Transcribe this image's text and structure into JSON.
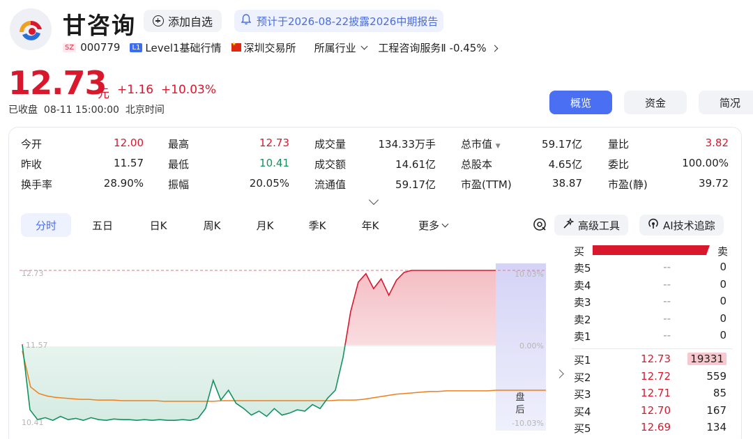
{
  "header": {
    "name": "甘咨询",
    "watch_label": "添加自选",
    "notice": "预计于2026-08-22披露2026中期报告",
    "market_tag": "SZ",
    "code": "000779",
    "level_tag": "L1",
    "level_label": "Level1基础行情",
    "exchange": "深圳交易所",
    "industry_label": "所属行业",
    "industry_value": "工程咨询服务Ⅱ",
    "industry_change": "-0.45%"
  },
  "quote": {
    "price": "12.73",
    "unit": "元",
    "change": "+1.16",
    "change_pct": "+10.03%",
    "status": "已收盘",
    "time": "08-11 15:00:00",
    "tz": "北京时间"
  },
  "tabs": [
    "概览",
    "资金",
    "简况"
  ],
  "stats": [
    [
      {
        "label": "今开",
        "value": "12.00",
        "color": "red"
      },
      {
        "label": "最高",
        "value": "12.73",
        "color": "red"
      },
      {
        "label": "成交量",
        "value": "134.33万手",
        "color": ""
      },
      {
        "label": "总市值",
        "value": "59.17亿",
        "color": ""
      },
      {
        "label": "量比",
        "value": "3.82",
        "color": "red"
      }
    ],
    [
      {
        "label": "昨收",
        "value": "11.57",
        "color": ""
      },
      {
        "label": "最低",
        "value": "10.41",
        "color": "green"
      },
      {
        "label": "成交额",
        "value": "14.61亿",
        "color": ""
      },
      {
        "label": "总股本",
        "value": "4.65亿",
        "color": ""
      },
      {
        "label": "委比",
        "value": "100.00%",
        "color": ""
      }
    ],
    [
      {
        "label": "换手率",
        "value": "28.90%",
        "color": ""
      },
      {
        "label": "振幅",
        "value": "20.05%",
        "color": ""
      },
      {
        "label": "流通值",
        "value": "59.17亿",
        "color": ""
      },
      {
        "label": "市盈(TTM)",
        "value": "38.87",
        "color": ""
      },
      {
        "label": "市盈(静)",
        "value": "39.72",
        "color": ""
      }
    ]
  ],
  "period_tabs": [
    "分时",
    "五日",
    "日K",
    "周K",
    "月K",
    "季K",
    "年K",
    "更多"
  ],
  "tools": {
    "advanced": "高级工具",
    "ai": "AI技术追踪"
  },
  "chart_data": {
    "type": "line",
    "y_labels": {
      "top": "12.73",
      "mid": "11.57",
      "bottom": "10.41"
    },
    "pct_labels": {
      "top": "10.03%",
      "mid": "0.00%",
      "bottom": "-10.03%"
    },
    "after_hours_label": "盘后",
    "ylim": [
      10.41,
      12.73
    ],
    "prev_close": 11.57,
    "price_series": [
      11.6,
      10.6,
      10.45,
      10.48,
      10.44,
      10.5,
      10.45,
      10.47,
      10.44,
      10.48,
      10.45,
      10.44,
      10.46,
      10.45,
      10.45,
      10.44,
      10.45,
      10.44,
      10.45,
      10.44,
      10.44,
      10.45,
      10.44,
      10.47,
      10.62,
      11.05,
      10.75,
      10.9,
      10.7,
      10.62,
      10.52,
      10.58,
      10.5,
      10.62,
      10.52,
      10.55,
      10.6,
      10.58,
      10.68,
      10.62,
      10.78,
      10.9,
      11.4,
      12.1,
      12.55,
      12.68,
      12.45,
      12.6,
      12.35,
      12.58,
      12.7,
      12.73,
      12.73,
      12.73,
      12.73,
      12.73,
      12.73,
      12.73,
      12.73,
      12.73,
      12.73,
      12.73,
      12.73
    ],
    "avg_series": [
      11.5,
      10.95,
      10.85,
      10.81,
      10.79,
      10.78,
      10.77,
      10.76,
      10.76,
      10.75,
      10.75,
      10.75,
      10.74,
      10.74,
      10.74,
      10.74,
      10.74,
      10.73,
      10.73,
      10.73,
      10.73,
      10.73,
      10.73,
      10.73,
      10.74,
      10.74,
      10.74,
      10.74,
      10.74,
      10.74,
      10.74,
      10.74,
      10.74,
      10.74,
      10.74,
      10.74,
      10.74,
      10.74,
      10.75,
      10.75,
      10.75,
      10.76,
      10.78,
      10.8,
      10.82,
      10.84,
      10.85,
      10.86,
      10.87,
      10.88,
      10.88,
      10.89,
      10.89,
      10.89,
      10.89,
      10.89,
      10.89,
      10.9,
      10.9,
      10.9,
      10.9,
      10.9,
      10.9
    ],
    "colors": {
      "up": "#d8182d",
      "down": "#139160",
      "avg": "#ef7f1a"
    }
  },
  "orderbook": {
    "buy_label": "买",
    "sell_label": "卖",
    "asks": [
      {
        "label": "卖5",
        "price": "--",
        "vol": "0"
      },
      {
        "label": "卖4",
        "price": "--",
        "vol": "0"
      },
      {
        "label": "卖3",
        "price": "--",
        "vol": "0"
      },
      {
        "label": "卖2",
        "price": "--",
        "vol": "0"
      },
      {
        "label": "卖1",
        "price": "--",
        "vol": "0"
      }
    ],
    "bids": [
      {
        "label": "买1",
        "price": "12.73",
        "vol": "19331"
      },
      {
        "label": "买2",
        "price": "12.72",
        "vol": "559"
      },
      {
        "label": "买3",
        "price": "12.71",
        "vol": "85"
      },
      {
        "label": "买4",
        "price": "12.70",
        "vol": "167"
      },
      {
        "label": "买5",
        "price": "12.69",
        "vol": "134"
      }
    ]
  }
}
